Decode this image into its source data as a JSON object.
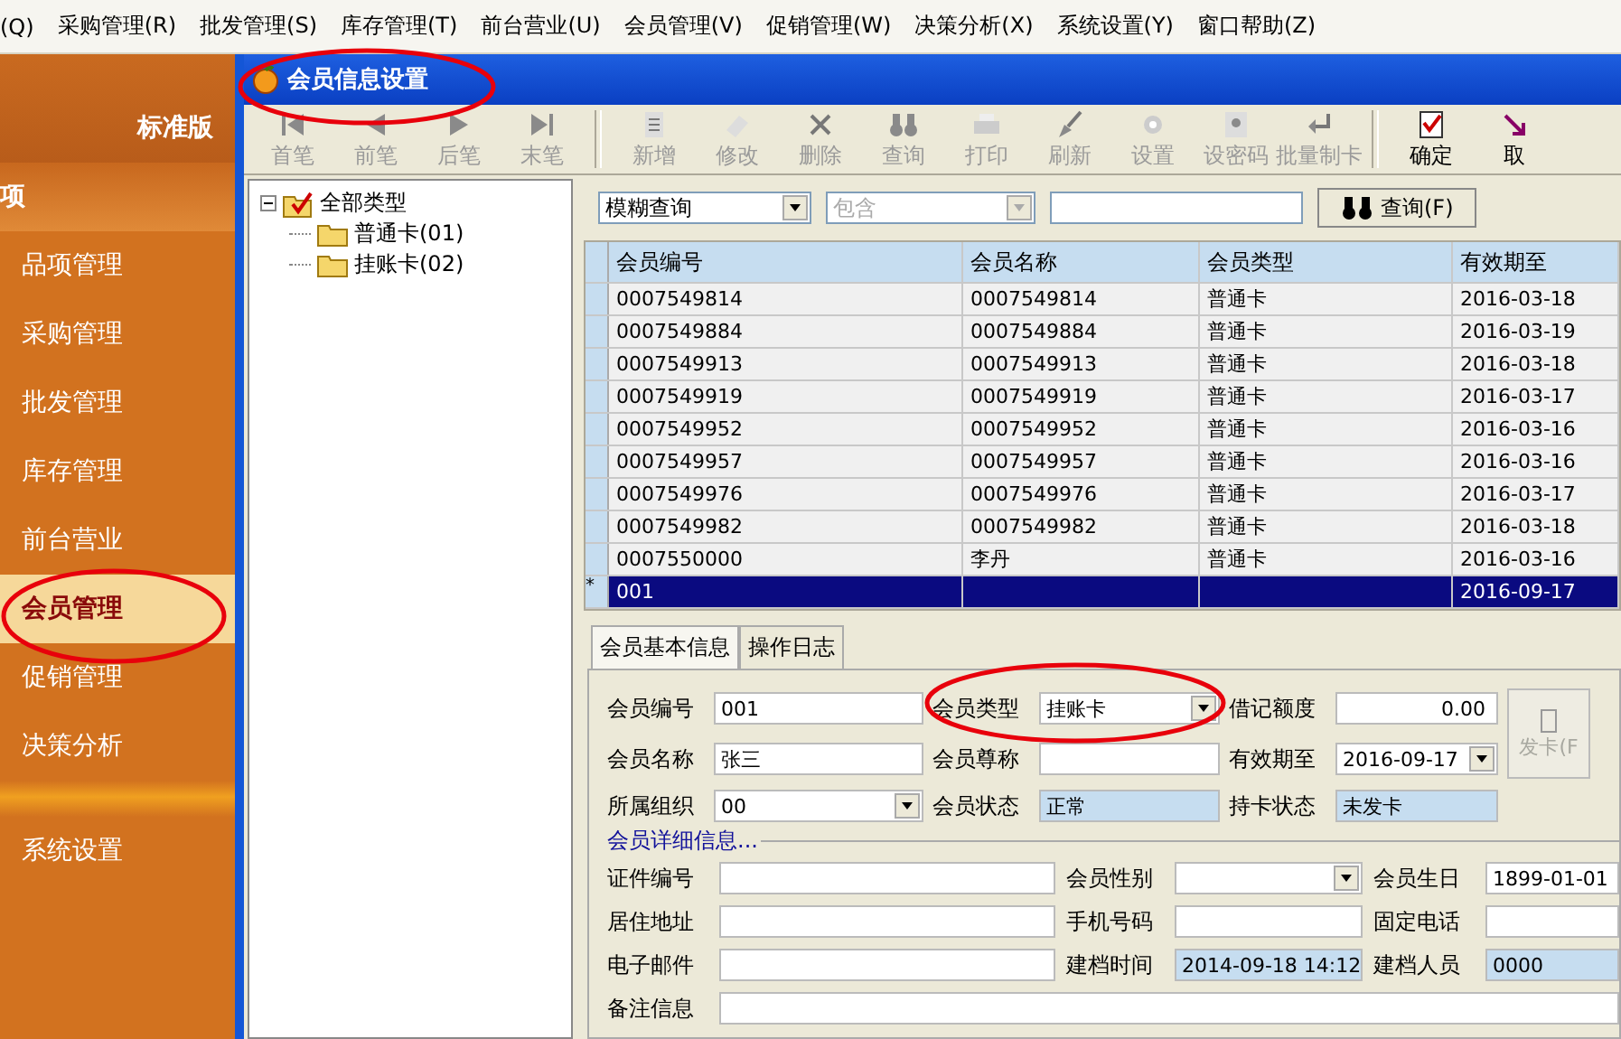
{
  "menu": [
    {
      "label": "(Q)"
    },
    {
      "label": "采购管理(R)"
    },
    {
      "label": "批发管理(S)"
    },
    {
      "label": "库存管理(T)"
    },
    {
      "label": "前台营业(U)"
    },
    {
      "label": "会员管理(V)"
    },
    {
      "label": "促销管理(W)"
    },
    {
      "label": "决策分析(X)"
    },
    {
      "label": "系统设置(Y)"
    },
    {
      "label": "窗口帮助(Z)"
    }
  ],
  "sidebar": {
    "edition": "标准版",
    "section": "项",
    "items": [
      {
        "label": "品项管理",
        "selected": false
      },
      {
        "label": "采购管理",
        "selected": false
      },
      {
        "label": "批发管理",
        "selected": false
      },
      {
        "label": "库存管理",
        "selected": false
      },
      {
        "label": "前台营业",
        "selected": false
      },
      {
        "label": "会员管理",
        "selected": true
      },
      {
        "label": "促销管理",
        "selected": false
      },
      {
        "label": "决策分析",
        "selected": false
      }
    ],
    "footer_items": [
      {
        "label": "系统设置",
        "selected": false
      }
    ]
  },
  "window": {
    "title": "会员信息设置"
  },
  "toolbar": {
    "groups": [
      [
        {
          "label": "首笔",
          "disabled": true
        },
        {
          "label": "前笔",
          "disabled": true
        },
        {
          "label": "后笔",
          "disabled": true
        },
        {
          "label": "末笔",
          "disabled": true
        }
      ],
      [
        {
          "label": "新增",
          "disabled": true
        },
        {
          "label": "修改",
          "disabled": true
        },
        {
          "label": "删除",
          "disabled": true
        },
        {
          "label": "查询",
          "disabled": true
        },
        {
          "label": "打印",
          "disabled": true
        },
        {
          "label": "刷新",
          "disabled": true
        },
        {
          "label": "设置",
          "disabled": true
        },
        {
          "label": "设密码",
          "disabled": true
        },
        {
          "label": "批量制卡",
          "disabled": true
        }
      ],
      [
        {
          "label": "确定",
          "disabled": false
        },
        {
          "label": "取",
          "disabled": false
        }
      ]
    ]
  },
  "tree": {
    "label": "全部类型",
    "checked": true,
    "expanded": true,
    "children": [
      {
        "label": "普通卡(01)"
      },
      {
        "label": "挂账卡(02)"
      }
    ]
  },
  "search": {
    "mode": "模糊查询",
    "operator": "包含",
    "operator_disabled": true,
    "button": "查询(F)"
  },
  "table": {
    "columns": [
      "会员编号",
      "会员名称",
      "会员类型",
      "有效期至"
    ],
    "rows": [
      {
        "marker": "",
        "selected": false,
        "cells": [
          "0007549814",
          "0007549814",
          "普通卡",
          "2016-03-18"
        ]
      },
      {
        "marker": "",
        "selected": false,
        "cells": [
          "0007549884",
          "0007549884",
          "普通卡",
          "2016-03-19"
        ]
      },
      {
        "marker": "",
        "selected": false,
        "cells": [
          "0007549913",
          "0007549913",
          "普通卡",
          "2016-03-18"
        ]
      },
      {
        "marker": "",
        "selected": false,
        "cells": [
          "0007549919",
          "0007549919",
          "普通卡",
          "2016-03-17"
        ]
      },
      {
        "marker": "",
        "selected": false,
        "cells": [
          "0007549952",
          "0007549952",
          "普通卡",
          "2016-03-16"
        ]
      },
      {
        "marker": "",
        "selected": false,
        "cells": [
          "0007549957",
          "0007549957",
          "普通卡",
          "2016-03-16"
        ]
      },
      {
        "marker": "",
        "selected": false,
        "cells": [
          "0007549976",
          "0007549976",
          "普通卡",
          "2016-03-17"
        ]
      },
      {
        "marker": "",
        "selected": false,
        "cells": [
          "0007549982",
          "0007549982",
          "普通卡",
          "2016-03-18"
        ]
      },
      {
        "marker": "",
        "selected": false,
        "cells": [
          "0007550000",
          "李丹",
          "普通卡",
          "2016-03-16"
        ]
      },
      {
        "marker": "*",
        "selected": true,
        "cells": [
          "001",
          "",
          "",
          "2016-09-17"
        ]
      }
    ]
  },
  "tabs": [
    {
      "label": "会员基本信息",
      "selected": true
    },
    {
      "label": "操作日志",
      "selected": false
    }
  ],
  "basic_fields": [
    {
      "label": "会员编号",
      "value": "001",
      "kind": "text"
    },
    {
      "label": "会员类型",
      "value": "挂账卡",
      "kind": "select"
    },
    {
      "label": "借记额度",
      "value": "0.00",
      "kind": "number"
    },
    {
      "label": "会员名称",
      "value": "张三",
      "kind": "text"
    },
    {
      "label": "会员尊称",
      "kind": "text"
    },
    {
      "label": "有效期至",
      "value": "2016-09-17",
      "kind": "select"
    },
    {
      "label": "所属组织",
      "value": "00",
      "kind": "select"
    },
    {
      "label": "会员状态",
      "value": "正常",
      "kind": "readonly"
    },
    {
      "label": "持卡状态",
      "value": "未发卡",
      "kind": "readonly"
    }
  ],
  "issue_button": {
    "label": "发卡(F",
    "disabled": true
  },
  "details_legend": "会员详细信息...",
  "detail_fields": [
    {
      "label": "证件编号",
      "kind": "text"
    },
    {
      "label": "会员性别",
      "kind": "select"
    },
    {
      "label": "会员生日",
      "value": "1899-01-01",
      "kind": "text"
    },
    {
      "label": "居住地址",
      "kind": "text"
    },
    {
      "label": "手机号码",
      "kind": "text"
    },
    {
      "label": "固定电话",
      "kind": "text"
    },
    {
      "label": "电子邮件",
      "kind": "text"
    },
    {
      "label": "建档时间",
      "value": "2014-09-18 14:12",
      "kind": "readonly"
    },
    {
      "label": "建档人员",
      "value": "0000",
      "kind": "readonly"
    }
  ],
  "remarks_field": {
    "label": "备注信息"
  }
}
